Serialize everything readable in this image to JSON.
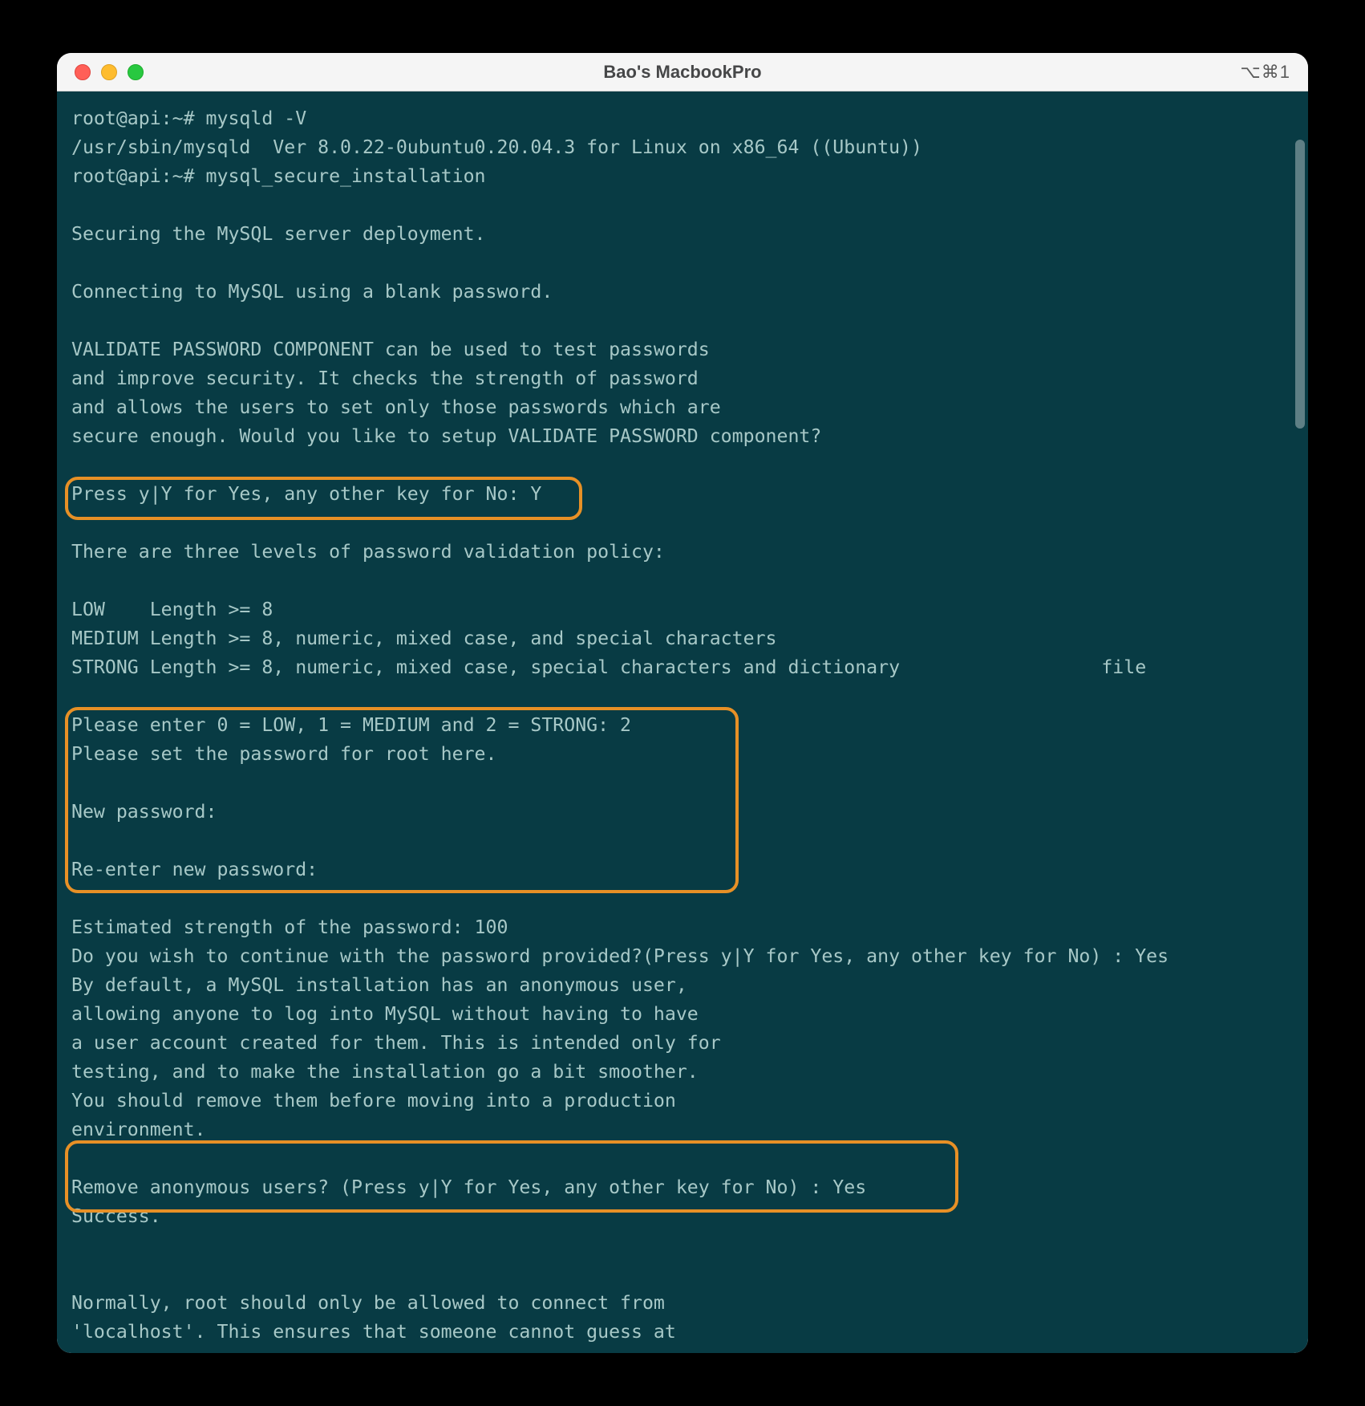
{
  "window": {
    "title": "Bao's MacbookPro",
    "shortcut_hint": "⌥⌘1"
  },
  "terminal": {
    "lines": [
      "root@api:~# mysqld -V",
      "/usr/sbin/mysqld  Ver 8.0.22-0ubuntu0.20.04.3 for Linux on x86_64 ((Ubuntu))",
      "root@api:~# mysql_secure_installation",
      "",
      "Securing the MySQL server deployment.",
      "",
      "Connecting to MySQL using a blank password.",
      "",
      "VALIDATE PASSWORD COMPONENT can be used to test passwords",
      "and improve security. It checks the strength of password",
      "and allows the users to set only those passwords which are",
      "secure enough. Would you like to setup VALIDATE PASSWORD component?",
      "",
      "Press y|Y for Yes, any other key for No: Y",
      "",
      "There are three levels of password validation policy:",
      "",
      "LOW    Length >= 8",
      "MEDIUM Length >= 8, numeric, mixed case, and special characters",
      "STRONG Length >= 8, numeric, mixed case, special characters and dictionary                  file",
      "",
      "Please enter 0 = LOW, 1 = MEDIUM and 2 = STRONG: 2",
      "Please set the password for root here.",
      "",
      "New password:",
      "",
      "Re-enter new password:",
      "",
      "Estimated strength of the password: 100",
      "Do you wish to continue with the password provided?(Press y|Y for Yes, any other key for No) : Yes",
      "By default, a MySQL installation has an anonymous user,",
      "allowing anyone to log into MySQL without having to have",
      "a user account created for them. This is intended only for",
      "testing, and to make the installation go a bit smoother.",
      "You should remove them before moving into a production",
      "environment.",
      "",
      "Remove anonymous users? (Press y|Y for Yes, any other key for No) : Yes",
      "Success.",
      "",
      "",
      "Normally, root should only be allowed to connect from",
      "'localhost'. This ensures that someone cannot guess at"
    ]
  },
  "colors": {
    "terminal_bg": "#083b44",
    "terminal_fg": "#a7c8c7",
    "highlight_border": "#e79026"
  }
}
